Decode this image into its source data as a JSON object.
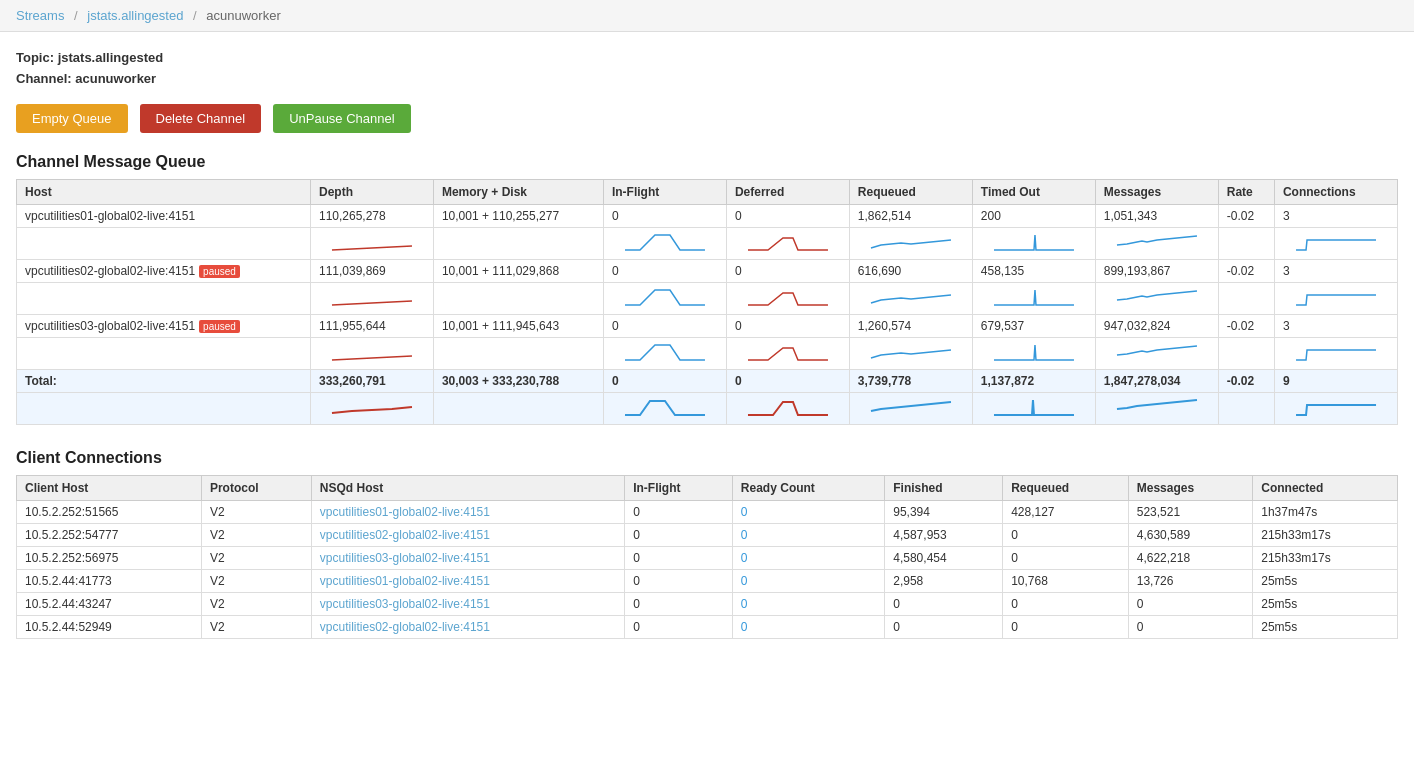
{
  "breadcrumb": {
    "streams_label": "Streams",
    "streams_href": "#",
    "topic_label": "jstats.allingested",
    "topic_href": "#",
    "channel_label": "acunuworker"
  },
  "topic_info": {
    "topic_prefix": "Topic:",
    "topic_name": "jstats.allingested",
    "channel_prefix": "Channel:",
    "channel_name": "acunuworker"
  },
  "buttons": {
    "empty_queue": "Empty Queue",
    "delete_channel": "Delete Channel",
    "unpause_channel": "UnPause Channel"
  },
  "queue_section": {
    "title": "Channel Message Queue",
    "columns": [
      "Host",
      "Depth",
      "Memory + Disk",
      "In-Flight",
      "Deferred",
      "Requeued",
      "Timed Out",
      "Messages",
      "Rate",
      "Connections"
    ],
    "rows": [
      {
        "host": "vpcutilities01-global02-live:4151",
        "paused": false,
        "depth": "110,265,278",
        "memory_disk": "10,001 + 110,255,277",
        "in_flight": "0",
        "deferred": "0",
        "requeued": "1,862,514",
        "timed_out": "200",
        "messages": "1,051,343",
        "rate": "-0.02",
        "connections": "3"
      },
      {
        "host": "vpcutilities02-global02-live:4151",
        "paused": true,
        "depth": "111,039,869",
        "memory_disk": "10,001 + 111,029,868",
        "in_flight": "0",
        "deferred": "0",
        "requeued": "616,690",
        "timed_out": "458,135",
        "messages": "899,193,867",
        "rate": "-0.02",
        "connections": "3"
      },
      {
        "host": "vpcutilities03-global02-live:4151",
        "paused": true,
        "depth": "111,955,644",
        "memory_disk": "10,001 + 111,945,643",
        "in_flight": "0",
        "deferred": "0",
        "requeued": "1,260,574",
        "timed_out": "679,537",
        "messages": "947,032,824",
        "rate": "-0.02",
        "connections": "3"
      }
    ],
    "total": {
      "label": "Total:",
      "depth": "333,260,791",
      "memory_disk": "30,003 + 333,230,788",
      "in_flight": "0",
      "deferred": "0",
      "requeued": "3,739,778",
      "timed_out": "1,137,872",
      "messages": "1,847,278,034",
      "rate": "-0.02",
      "connections": "9"
    },
    "paused_label": "paused"
  },
  "connections_section": {
    "title": "Client Connections",
    "columns": [
      "Client Host",
      "Protocol",
      "NSQd Host",
      "In-Flight",
      "Ready Count",
      "Finished",
      "Requeued",
      "Messages",
      "Connected"
    ],
    "rows": [
      {
        "client_host": "10.5.2.252:51565",
        "protocol": "V2",
        "nsqd_host": "vpcutilities01-global02-live:4151",
        "in_flight": "0",
        "ready_count": "0",
        "finished": "95,394",
        "requeued": "428,127",
        "messages": "523,521",
        "connected": "1h37m47s"
      },
      {
        "client_host": "10.5.2.252:54777",
        "protocol": "V2",
        "nsqd_host": "vpcutilities02-global02-live:4151",
        "in_flight": "0",
        "ready_count": "0",
        "finished": "4,587,953",
        "requeued": "0",
        "messages": "4,630,589",
        "connected": "215h33m17s"
      },
      {
        "client_host": "10.5.2.252:56975",
        "protocol": "V2",
        "nsqd_host": "vpcutilities03-global02-live:4151",
        "in_flight": "0",
        "ready_count": "0",
        "finished": "4,580,454",
        "requeued": "0",
        "messages": "4,622,218",
        "connected": "215h33m17s"
      },
      {
        "client_host": "10.5.2.44:41773",
        "protocol": "V2",
        "nsqd_host": "vpcutilities01-global02-live:4151",
        "in_flight": "0",
        "ready_count": "0",
        "finished": "2,958",
        "requeued": "10,768",
        "messages": "13,726",
        "connected": "25m5s"
      },
      {
        "client_host": "10.5.2.44:43247",
        "protocol": "V2",
        "nsqd_host": "vpcutilities03-global02-live:4151",
        "in_flight": "0",
        "ready_count": "0",
        "finished": "0",
        "requeued": "0",
        "messages": "0",
        "connected": "25m5s"
      },
      {
        "client_host": "10.5.2.44:52949",
        "protocol": "V2",
        "nsqd_host": "vpcutilities02-global02-live:4151",
        "in_flight": "0",
        "ready_count": "0",
        "finished": "0",
        "requeued": "0",
        "messages": "0",
        "connected": "25m5s"
      }
    ]
  }
}
